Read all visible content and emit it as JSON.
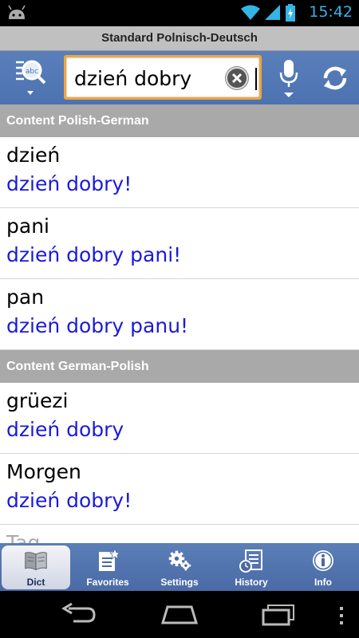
{
  "status_bar": {
    "time": "15:42",
    "icons": [
      "android-icon",
      "wifi-icon",
      "signal-icon",
      "battery-charging-icon"
    ],
    "accent_color": "#33b5e5"
  },
  "title_bar": {
    "title": "Standard Polnisch-Deutsch"
  },
  "toolbar": {
    "dictionary_switch_icon": "abc-magnifier-icon",
    "search_value": "dzień dobry",
    "voice_icon": "microphone-icon",
    "swap_icon": "refresh-icon",
    "search_border_color": "#f2a43a"
  },
  "sections": [
    {
      "header": "Content Polish-German",
      "entries": [
        {
          "word": "dzień",
          "example": "dzień dobry!"
        },
        {
          "word": "pani",
          "example": "dzień dobry pani!"
        },
        {
          "word": "pan",
          "example": "dzień dobry panu!"
        }
      ]
    },
    {
      "header": "Content German-Polish",
      "entries": [
        {
          "word": "grüezi",
          "example": "dzień dobry"
        },
        {
          "word": "Morgen",
          "example": "dzień dobry!"
        },
        {
          "word": "Tag",
          "example": ""
        }
      ]
    }
  ],
  "tabs": [
    {
      "label": "Dict",
      "icon": "book-icon",
      "active": true
    },
    {
      "label": "Favorites",
      "icon": "favorites-list-icon",
      "active": false
    },
    {
      "label": "Settings",
      "icon": "gears-icon",
      "active": false
    },
    {
      "label": "History",
      "icon": "history-list-icon",
      "active": false
    },
    {
      "label": "Info",
      "icon": "info-icon",
      "active": false
    }
  ],
  "navbar": {
    "buttons": [
      "back-icon",
      "home-icon",
      "recent-apps-icon"
    ]
  },
  "colors": {
    "toolbar_blue": "#4c72b0",
    "example_blue": "#1a1adc",
    "section_gray": "#a9a9a9"
  }
}
